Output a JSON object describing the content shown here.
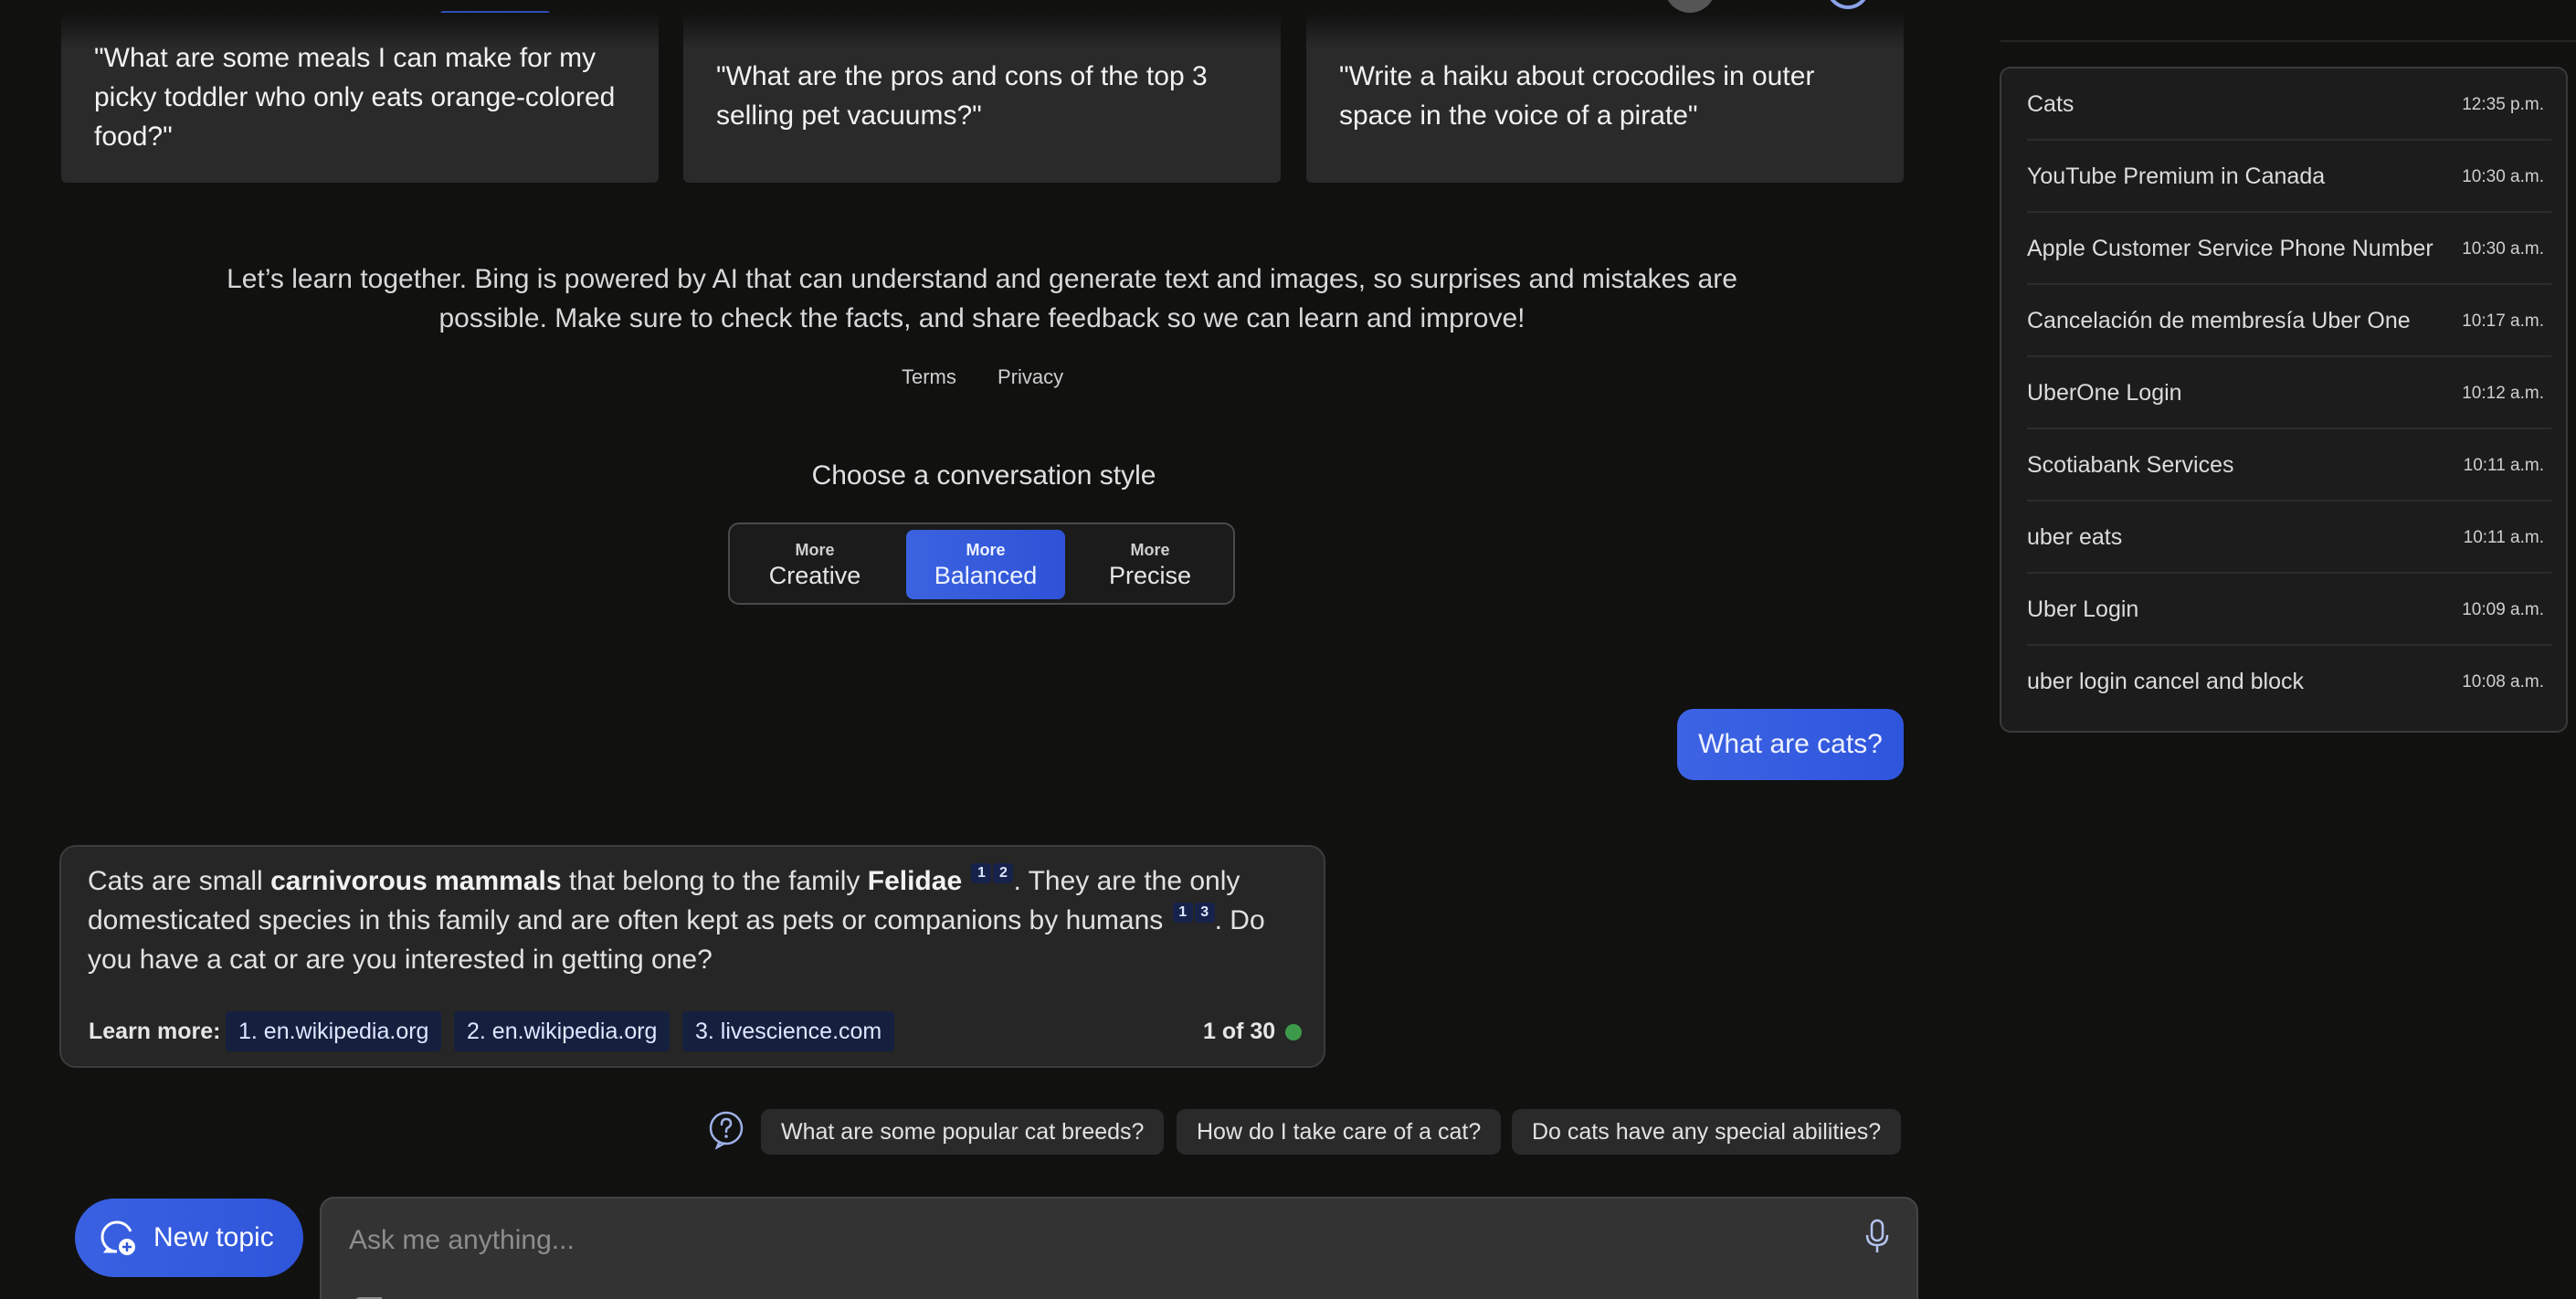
{
  "prompt_cards": [
    {
      "text": "\"What are some meals I can make for my picky toddler who only eats orange-colored food?\""
    },
    {
      "text": "\"What are the pros and cons of the top 3 selling pet vacuums?\""
    },
    {
      "text": "\"Write a haiku about crocodiles in outer space in the voice of a pirate\""
    }
  ],
  "disclaimer": "Let’s learn together. Bing is powered by AI that can understand and generate text and images, so surprises and mistakes are possible. Make sure to check the facts, and share feedback so we can learn and improve!",
  "links": {
    "terms": "Terms",
    "privacy": "Privacy"
  },
  "conversation_style": {
    "title": "Choose a conversation style",
    "options": [
      {
        "small": "More",
        "label": "Creative"
      },
      {
        "small": "More",
        "label": "Balanced",
        "selected": true
      },
      {
        "small": "More",
        "label": "Precise"
      }
    ]
  },
  "user_message": "What are cats?",
  "bot_message": {
    "p1": "Cats are small ",
    "b1": "carnivorous mammals",
    "p2": " that belong to the family ",
    "b2": "Felidae",
    "p3": ". They are the only domesticated species in this family and are often kept as pets or companions by humans",
    "p4": ". Do you have a cat or are you interested in getting one?",
    "cites_a": [
      "1",
      "2"
    ],
    "cites_b": [
      "1",
      "3"
    ],
    "learn_more_label": "Learn more:",
    "sources": [
      "1. en.wikipedia.org",
      "2. en.wikipedia.org",
      "3. livescience.com"
    ],
    "count": "1 of 30"
  },
  "suggestions": [
    "What are some popular cat breeds?",
    "How do I take care of a cat?",
    "Do cats have any special abilities?"
  ],
  "composer": {
    "new_topic": "New topic",
    "placeholder": "Ask me anything..."
  },
  "recent_activity": [
    {
      "title": "Cats",
      "time": "12:35 p.m."
    },
    {
      "title": "YouTube Premium in Canada",
      "time": "10:30 a.m."
    },
    {
      "title": "Apple Customer Service Phone Number",
      "time": "10:30 a.m."
    },
    {
      "title": "Cancelación de membresía Uber One",
      "time": "10:17 a.m."
    },
    {
      "title": "UberOne Login",
      "time": "10:12 a.m."
    },
    {
      "title": "Scotiabank Services",
      "time": "10:11 a.m."
    },
    {
      "title": "uber eats",
      "time": "10:11 a.m."
    },
    {
      "title": "Uber Login",
      "time": "10:09 a.m."
    },
    {
      "title": "uber login cancel and block",
      "time": "10:08 a.m."
    }
  ],
  "colors": {
    "accent": "#3b63e0",
    "citation_bg": "#16224a",
    "status_green": "#3e9a4b"
  }
}
